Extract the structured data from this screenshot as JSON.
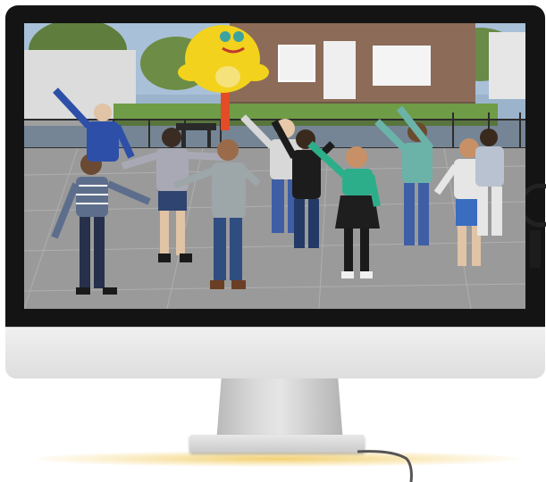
{
  "image": {
    "subject": "monitor-displaying-schoolyard-dance-photo",
    "colors": {
      "bezel": "#141414",
      "chin": "#e6e6e6",
      "stand": "#d0d0d0",
      "floor_glow": "#f0c85a",
      "pavement": "#9a9a9a",
      "brick": "#8a6a55",
      "mascot": "#f2d21c",
      "sky": "#9bb4cc"
    },
    "icons": [
      "monitor-icon"
    ]
  }
}
